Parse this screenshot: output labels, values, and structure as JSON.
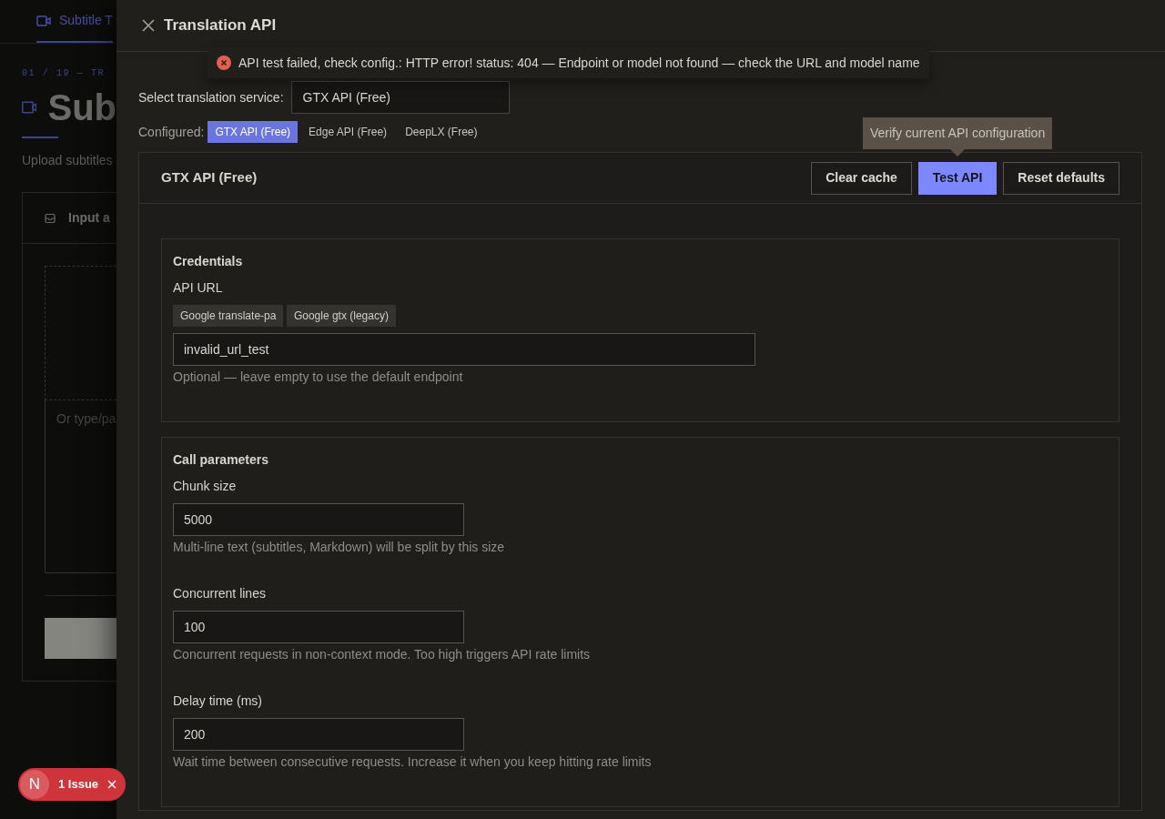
{
  "background_page": {
    "tab": "Subtitle T",
    "step": "01 / 19 — TR",
    "title": "Sub",
    "subtitle": "Upload subtitles",
    "card_title": "Input a",
    "textarea_placeholder": "Or type/pa"
  },
  "drawer": {
    "title": "Translation API"
  },
  "toast": {
    "kind": "error",
    "message": "API test failed, check config.: HTTP error! status: 404 — Endpoint or model not found — check the URL and model name"
  },
  "service_select": {
    "label": "Select translation service:",
    "value": "GTX API (Free)"
  },
  "configured": {
    "label": "Configured:",
    "items": [
      {
        "label": "GTX API (Free)",
        "selected": true
      },
      {
        "label": "Edge API (Free)",
        "selected": false
      },
      {
        "label": "DeepLX (Free)",
        "selected": false
      }
    ]
  },
  "panel": {
    "title": "GTX API (Free)",
    "buttons": [
      {
        "label": "Clear cache",
        "primary": false
      },
      {
        "label": "Test API",
        "primary": true,
        "tooltip": "Verify current API configuration"
      },
      {
        "label": "Reset defaults",
        "primary": false
      }
    ],
    "sections": [
      {
        "title": "Credentials",
        "fields": [
          {
            "kind": "url",
            "label": "API URL",
            "presets": [
              "Google translate-pa",
              "Google gtx (legacy)"
            ],
            "value": "invalid_url_test",
            "help": "Optional — leave empty to use the default endpoint"
          }
        ]
      },
      {
        "title": "Call parameters",
        "fields": [
          {
            "kind": "number",
            "label": "Chunk size",
            "value": "5000",
            "help": "Multi-line text (subtitles, Markdown) will be split by this size"
          },
          {
            "kind": "number",
            "label": "Concurrent lines",
            "value": "100",
            "help": "Concurrent requests in non-context mode. Too high triggers API rate limits"
          },
          {
            "kind": "number",
            "label": "Delay time (ms)",
            "value": "200",
            "help": "Wait time between consecutive requests. Increase it when you keep hitting rate limits"
          }
        ]
      }
    ]
  },
  "issue_badge": {
    "avatar": "N",
    "label": "1 Issue"
  }
}
